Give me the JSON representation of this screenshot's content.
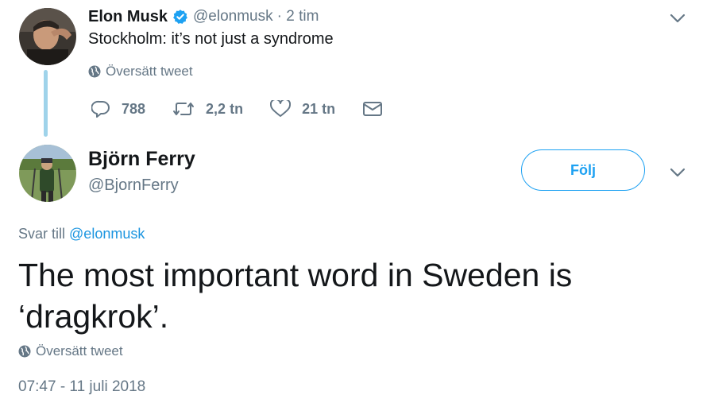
{
  "tweet1": {
    "author_name": "Elon Musk",
    "handle": "@elonmusk",
    "time": "· 2 tim",
    "text": "Stockholm: it’s not just a syndrome",
    "translate_label": "Översätt tweet",
    "stats": {
      "replies": "788",
      "retweets": "2,2 tn",
      "likes": "21 tn"
    }
  },
  "tweet2": {
    "author_name": "Björn Ferry",
    "handle": "@BjornFerry",
    "follow_label": "Följ",
    "reply_prefix": "Svar till",
    "reply_mention": "@elonmusk",
    "text": "The most important word in Sweden is ‘dragkrok’.",
    "translate_label": "Översätt tweet",
    "timestamp": "07:47 - 11 juli 2018"
  },
  "colors": {
    "accent": "#1da1f2",
    "link": "#1b95e0",
    "muted": "#657786",
    "text": "#14171a",
    "thread_line": "#9fd3ea"
  },
  "icons": [
    "verified-badge-icon",
    "globe-icon",
    "reply-icon",
    "retweet-icon",
    "like-icon",
    "direct-message-icon",
    "chevron-down-icon"
  ]
}
